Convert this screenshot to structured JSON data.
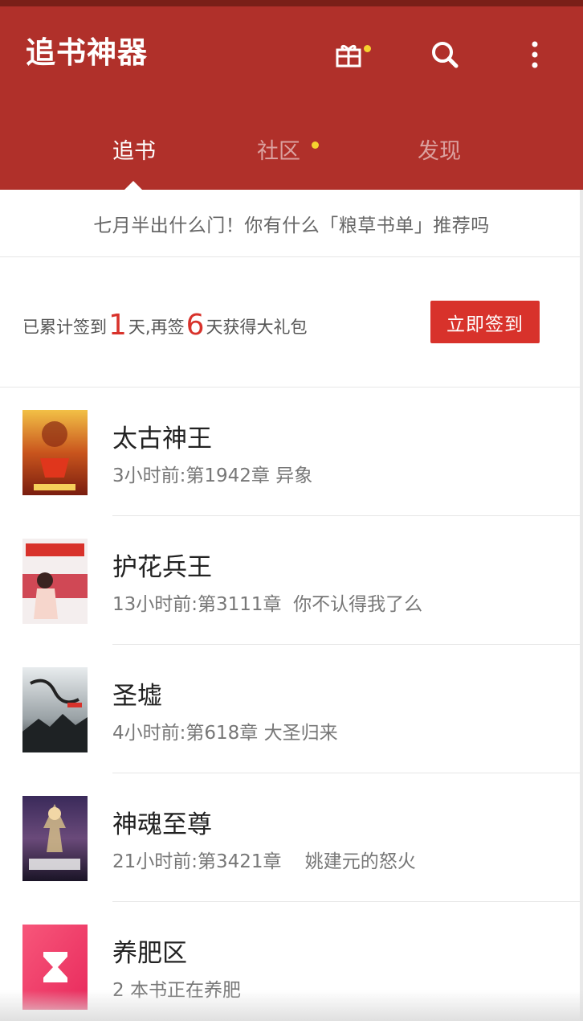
{
  "app": {
    "title": "追书神器"
  },
  "header": {
    "icons": [
      "gift-icon",
      "search-icon",
      "more-vert-icon"
    ],
    "tabs": [
      {
        "label": "追书",
        "active": true
      },
      {
        "label": "社区",
        "active": false,
        "has_dot": true
      },
      {
        "label": "发现",
        "active": false
      }
    ]
  },
  "notice": {
    "text": "七月半出什么门！你有什么「粮草书单」推荐吗"
  },
  "checkin": {
    "prefix": "已累计签到",
    "days_signed": "1",
    "middle": "天,再签",
    "days_remaining": "6",
    "suffix": "天获得大礼包",
    "button_label": "立即签到"
  },
  "books": [
    {
      "title": "太古神王",
      "update": "3小时前:第1942章 异象"
    },
    {
      "title": "护花兵王",
      "update": "13小时前:第3111章  你不认得我了么"
    },
    {
      "title": "圣墟",
      "update": "4小时前:第618章 大圣归来"
    },
    {
      "title": "神魂至尊",
      "update": "21小时前:第3421章    姚建元的怒火"
    },
    {
      "title": "养肥区",
      "update": "2 本书正在养肥"
    }
  ],
  "colors": {
    "header_bg": "#b0302a",
    "accent": "#d8322b",
    "notification_dot": "#f6d22f"
  }
}
